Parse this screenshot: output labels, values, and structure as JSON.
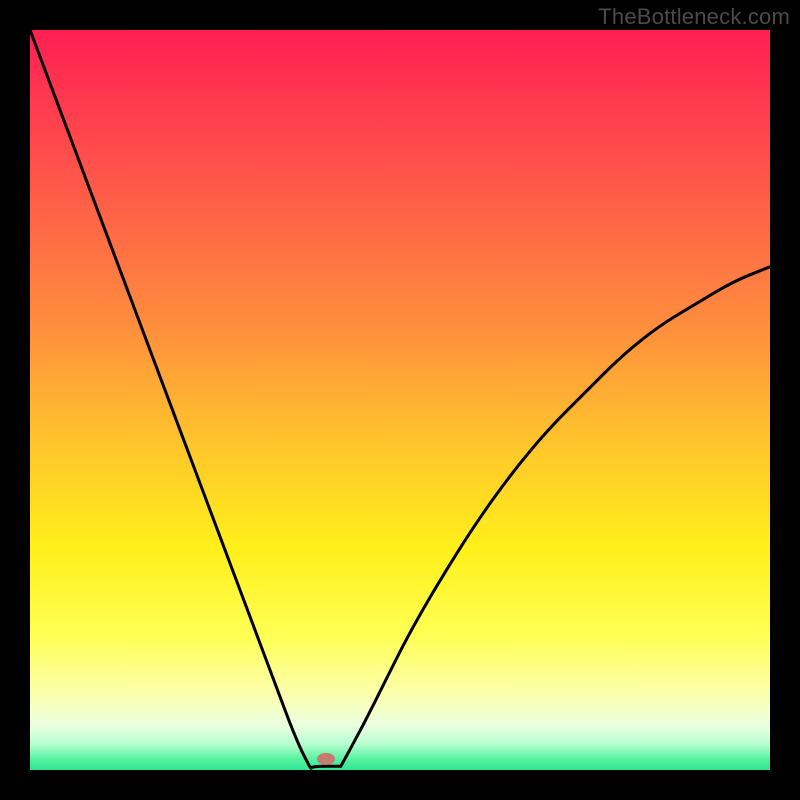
{
  "watermark": "TheBottleneck.com",
  "chart_data": {
    "type": "line",
    "title": "",
    "xlabel": "",
    "ylabel": "",
    "xlim": [
      0,
      100
    ],
    "ylim": [
      0,
      100
    ],
    "x_min_percent": 38,
    "marker": {
      "x": 40,
      "y": 1.5,
      "color": "#c77a6e"
    },
    "series": [
      {
        "name": "bottleneck-curve",
        "x_left": [
          0,
          3,
          6,
          9,
          12,
          15,
          18,
          21,
          24,
          27,
          30,
          33,
          36,
          38
        ],
        "y_left": [
          100,
          92,
          84,
          76,
          68,
          60,
          52,
          44,
          36,
          28,
          20,
          12,
          4,
          0
        ],
        "x_flat": [
          38,
          42
        ],
        "y_flat": [
          0.5,
          0.5
        ],
        "x_right": [
          42,
          45,
          48,
          51,
          55,
          60,
          65,
          70,
          75,
          80,
          85,
          90,
          95,
          100
        ],
        "y_right": [
          0.5,
          6,
          12,
          18,
          25,
          33,
          40,
          46,
          51,
          56,
          60,
          63,
          66,
          68
        ]
      }
    ],
    "background_gradient": {
      "stops": [
        {
          "offset": 0.0,
          "color": "#ff1f52"
        },
        {
          "offset": 0.2,
          "color": "#ff564a"
        },
        {
          "offset": 0.4,
          "color": "#ff8e3d"
        },
        {
          "offset": 0.55,
          "color": "#ffc22d"
        },
        {
          "offset": 0.7,
          "color": "#fff01a"
        },
        {
          "offset": 0.82,
          "color": "#ffff55"
        },
        {
          "offset": 0.9,
          "color": "#faffb0"
        },
        {
          "offset": 0.94,
          "color": "#eaffe0"
        },
        {
          "offset": 0.965,
          "color": "#b6ffd0"
        },
        {
          "offset": 0.985,
          "color": "#58f2a0"
        },
        {
          "offset": 1.0,
          "color": "#2ee695"
        }
      ]
    }
  }
}
